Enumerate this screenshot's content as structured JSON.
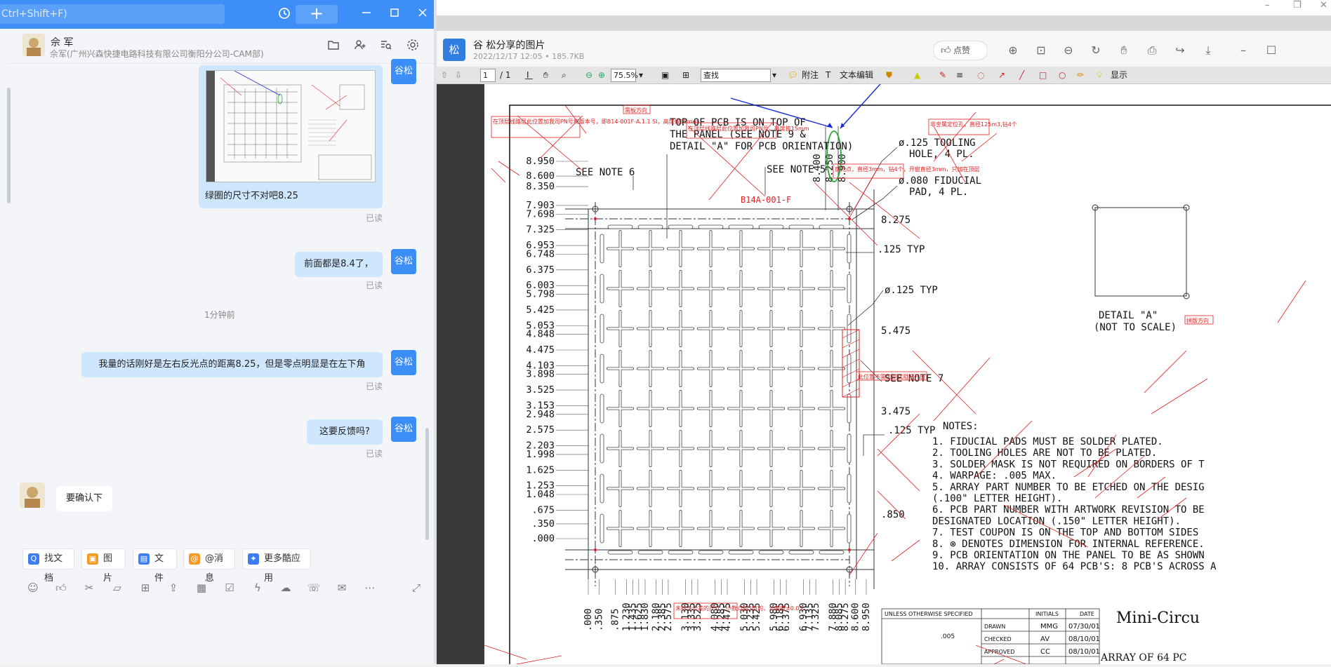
{
  "chat": {
    "search_placeholder": "Ctrl+Shift+F)",
    "contact_name": "佘 军",
    "contact_company": "佘军(广州兴森快捷电路科技有限公司衡阳分公司-CAM部)",
    "messages": [
      {
        "id": "m1",
        "text": "绿圈的尺寸不对吧8.25",
        "read": "已读",
        "sender": "谷松"
      },
      {
        "id": "m2",
        "text": "前面都是8.4了，",
        "read": "已读",
        "sender": "谷松"
      },
      {
        "id": "m3",
        "text": "我量的话刚好是左右反光点的距离8.25，但是零点明显是在左下角",
        "read": "已读",
        "sender": "谷松"
      },
      {
        "id": "m4",
        "text": "这要反馈吗?",
        "read": "已读",
        "sender": "谷松"
      },
      {
        "id": "m5",
        "text": "要确认下",
        "sender": "佘军"
      }
    ],
    "timestamp": "1分钟前",
    "apps": [
      "找文档",
      "图片",
      "文件",
      "@消息",
      "更多酷应用"
    ]
  },
  "viewer": {
    "logo_char": "松",
    "title": "谷 松分享的图片",
    "meta": "2022/12/17 12:05 • 185.7KB",
    "like_label": "点赞"
  },
  "pdf_toolbar": {
    "page_current": "1",
    "page_total": "/ 1",
    "zoom": "75.5%",
    "search_placeholder": "查找",
    "attach_label": "附注",
    "text_edit_label": "文本编辑",
    "display_label": "显示"
  },
  "drawing": {
    "top_note": [
      "TOP OF PCB IS ON TOP OF",
      "THE PANEL (SEE NOTE 9 &",
      "DETAIL \"A\" FOR PCB ORIENTATION)"
    ],
    "see_note_6": "SEE NOTE 6",
    "see_note_5": "SEE NOTE 5",
    "see_note_7": "SEE NOTE 7",
    "part_label": "B14A-001-F",
    "tooling": [
      "ø.125 TOOLING",
      "HOLE, 4 PL."
    ],
    "fiducial": [
      "ø.080 FIDUCIAL",
      "PAD, 4 PL."
    ],
    "typ_125": ".125 TYP",
    "dia_125_typ": "ø.125 TYP",
    "typ_125b": ".125 TYP",
    "right_dims": [
      "8.275",
      "5.475",
      "3.475",
      ".850"
    ],
    "top_vert_dims": [
      "8.400",
      "8.250",
      "8.900"
    ],
    "left_dims": [
      "8.950",
      "8.600",
      "8.350",
      "7.903",
      "7.698",
      "7.325",
      "6.953",
      "6.748",
      "6.375",
      "6.003",
      "5.798",
      "5.425",
      "5.053",
      "4.848",
      "4.475",
      "4.103",
      "3.898",
      "3.525",
      "3.153",
      "2.948",
      "2.575",
      "2.203",
      "1.998",
      "1.625",
      "1.253",
      "1.048",
      ".675",
      ".350",
      ".000"
    ],
    "bottom_dims": [
      ".000",
      ".350",
      ".875",
      "1.230",
      "1.435",
      "1.625",
      "1.830",
      "2.180",
      "2.385",
      "2.575",
      "3.130",
      "3.335",
      "3.525",
      "4.080",
      "4.285",
      "4.475",
      "5.030",
      "5.235",
      "5.425",
      "5.980",
      "6.185",
      "6.375",
      "6.930",
      "7.135",
      "7.325",
      "7.880",
      "8.085",
      "8.275",
      "8.600",
      "8.950"
    ],
    "detail_title": "DETAIL \"A\"",
    "detail_sub": "(NOT TO SCALE)",
    "notes_title": "NOTES:",
    "notes": [
      "1. FIDUCIAL PADS MUST BE SOLDER PLATED.",
      "2. TOOLING HOLES ARE NOT TO BE PLATED.",
      "3. SOLDER MASK IS NOT REQUIRED ON BORDERS OF T",
      "4. WARPAGE: .005 MAX.",
      "5. ARRAY PART NUMBER TO BE ETCHED ON THE DESIG",
      "   (.100\" LETTER HEIGHT).",
      "6. PCB PART NUMBER WITH ARTWORK REVISION TO BE",
      "   DESIGNATED LOCATION (.150\" LETTER HEIGHT).",
      "7. TEST COUPON IS ON THE TOP AND BOTTOM SIDES",
      "8. ⊗  DENOTES DIMENSION FOR INTERNAL REFERENCE.",
      "9. PCB ORIENTATION ON THE PANEL TO BE AS SHOWN",
      "10. ARRAY CONSISTS OF 64 PCB'S: 8 PCB'S ACROSS A"
    ],
    "title_block": {
      "unless": "UNLESS OTHERWISE SPECIFIED",
      "initials": "INITIALS",
      "date": "DATE",
      "rows": [
        {
          "label": "DRAWN",
          "init": "MMG",
          "date": "07/30/01"
        },
        {
          "label": "CHECKED",
          "init": "AV",
          "date": "08/10/01"
        },
        {
          "label": "APPROVED",
          "init": "CC",
          "date": "08/10/01"
        }
      ],
      "tol": ".005",
      "company": "Mini-Circu",
      "array": "ARRAY OF 64 PC"
    },
    "red_notes": {
      "r1": "需板方向",
      "r2": "在顶层线路层此位置加我司PN号和版本号，即B14-001F-A.1.1 SI，高度按15mm",
      "r3": "在顶层线路层此位置加我司PN号，高度按15mm",
      "r4": "非金属定位孔，直径125m3,钻4个",
      "r5": "反光点，直径3mm，钻4个，开窗直径3mm，只加在顶层",
      "r6": "此位置不需加测试阻抗开窗",
      "r7": "拼版方向",
      "r8": "未标注公差的尺寸，小数点后3位的，公差按±0.05"
    }
  }
}
